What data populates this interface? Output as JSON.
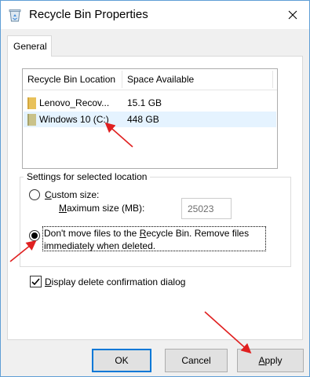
{
  "window": {
    "title": "Recycle Bin Properties"
  },
  "tabs": [
    {
      "label": "General"
    }
  ],
  "location_list": {
    "columns": [
      "Recycle Bin Location",
      "Space Available"
    ],
    "rows": [
      {
        "location": "Lenovo_Recov...",
        "space": "15.1 GB",
        "selected": false
      },
      {
        "location": "Windows 10 (C:)",
        "space": "448 GB",
        "selected": true
      }
    ]
  },
  "settings": {
    "group_label": "Settings for selected location",
    "custom_size": {
      "label_pre": "",
      "mnemonic": "C",
      "label_post": "ustom size:",
      "checked": false
    },
    "max_size": {
      "label_pre": "M",
      "label_post": "aximum size (MB):",
      "value": "25023"
    },
    "dont_move": {
      "line1_pre": "Don't move files to the ",
      "mnemonic": "R",
      "line1_post": "ecycle Bin. Remove files",
      "line2": "immediately when deleted.",
      "checked": true
    }
  },
  "confirm_dialog": {
    "mnemonic": "D",
    "label_post": "isplay delete confirmation dialog",
    "checked": true
  },
  "buttons": {
    "ok": "OK",
    "cancel": "Cancel",
    "apply_mnemonic": "A",
    "apply_post": "pply"
  },
  "colors": {
    "annotation_arrow": "#e02020",
    "selection": "#e5f3ff",
    "default_button_border": "#0078d7",
    "folder": "#e8c15b"
  }
}
